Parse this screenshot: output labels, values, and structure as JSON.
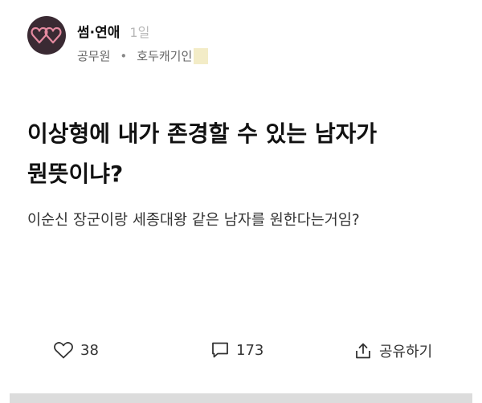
{
  "post": {
    "board": "썸·연애",
    "time_ago": "1일",
    "author_job": "공무원",
    "author_company": "호두캐기인",
    "title_line1": "이상형에 내가 존경할 수 있는 남자가",
    "title_line2": "뭔뜻이냐?",
    "body": "이순신 장군이랑 세종대왕 같은 남자를 원한다는거임?"
  },
  "actions": {
    "likes": "38",
    "comments": "173",
    "share_label": "공유하기"
  },
  "icons": {
    "avatar": "heart-pair-icon",
    "like": "heart-outline-icon",
    "comment": "chat-bubble-icon",
    "share": "share-up-icon"
  },
  "colors": {
    "avatar_bg": "#3a2a33",
    "avatar_hearts": "#e48aa0",
    "highlight": "#f3ecc7"
  }
}
